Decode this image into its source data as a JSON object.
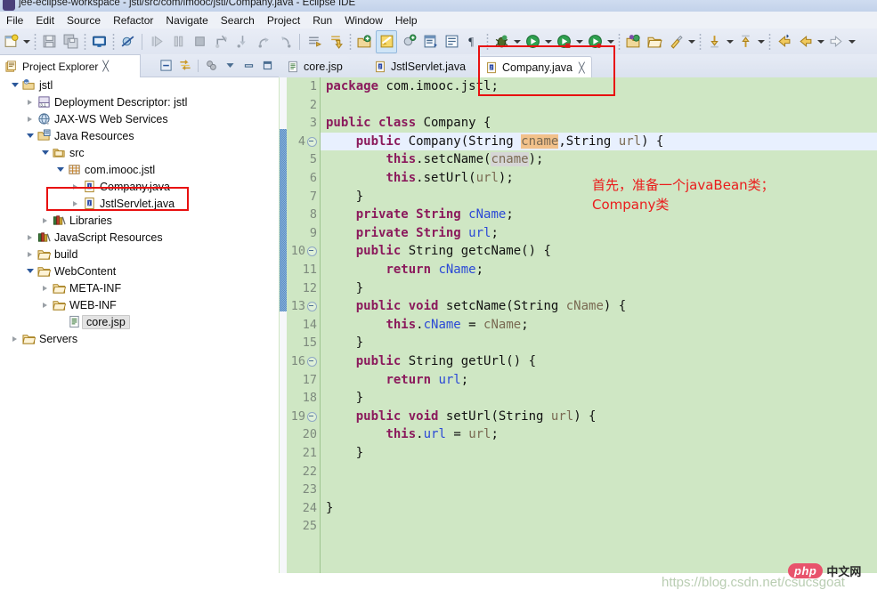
{
  "window": {
    "title": "jee-eclipse-workspace - jstl/src/com/imooc/jstl/Company.java - Eclipse IDE",
    "app_icon": "eclipse-icon"
  },
  "menu": {
    "items": [
      {
        "label": "File"
      },
      {
        "label": "Edit"
      },
      {
        "label": "Source"
      },
      {
        "label": "Refactor"
      },
      {
        "label": "Navigate"
      },
      {
        "label": "Search"
      },
      {
        "label": "Project"
      },
      {
        "label": "Run"
      },
      {
        "label": "Window"
      },
      {
        "label": "Help"
      }
    ]
  },
  "toolbar": {
    "items": [
      {
        "name": "new-wizard-icon",
        "type": "icon"
      },
      {
        "name": "new-wizard-dropdown",
        "type": "arrow"
      },
      {
        "name": "sep1",
        "type": "dots"
      },
      {
        "name": "save-icon",
        "type": "icon"
      },
      {
        "name": "save-all-icon",
        "type": "icon"
      },
      {
        "name": "sep2",
        "type": "dots"
      },
      {
        "name": "open-console-icon",
        "type": "icon"
      },
      {
        "name": "sep3",
        "type": "dots"
      },
      {
        "name": "skip-breakpoints-icon",
        "type": "icon"
      },
      {
        "name": "sep4",
        "type": "bar"
      },
      {
        "name": "resume-icon",
        "type": "icon"
      },
      {
        "name": "suspend-icon",
        "type": "icon"
      },
      {
        "name": "terminate-icon",
        "type": "icon"
      },
      {
        "name": "disconnect-icon",
        "type": "icon"
      },
      {
        "name": "step-into-icon",
        "type": "icon"
      },
      {
        "name": "step-over-icon",
        "type": "icon"
      },
      {
        "name": "step-return-icon",
        "type": "icon"
      },
      {
        "name": "sep5",
        "type": "bar"
      },
      {
        "name": "next-annotation-icon",
        "type": "icon"
      },
      {
        "name": "previous-annotation-icon",
        "type": "icon"
      },
      {
        "name": "sep6",
        "type": "dots"
      },
      {
        "name": "new-java-project-icon",
        "type": "icon"
      },
      {
        "name": "new-java-class-icon",
        "type": "icon"
      },
      {
        "name": "new-package-icon",
        "type": "icon"
      },
      {
        "name": "open-type-icon",
        "type": "icon"
      },
      {
        "name": "toggle-mark-occurrences-icon",
        "type": "icon"
      },
      {
        "name": "show-whitespace-icon",
        "type": "icon"
      },
      {
        "name": "sep7",
        "type": "dots"
      },
      {
        "name": "debug-icon",
        "type": "icon"
      },
      {
        "name": "debug-dropdown",
        "type": "arrow"
      },
      {
        "name": "run-icon",
        "type": "icon"
      },
      {
        "name": "run-dropdown",
        "type": "arrow"
      },
      {
        "name": "run-as-server-icon",
        "type": "icon"
      },
      {
        "name": "run-as-server-dropdown",
        "type": "arrow"
      },
      {
        "name": "coverage-icon",
        "type": "icon"
      },
      {
        "name": "coverage-dropdown",
        "type": "arrow"
      },
      {
        "name": "sep8",
        "type": "dots"
      },
      {
        "name": "new-server-icon",
        "type": "icon"
      },
      {
        "name": "open-folder-icon",
        "type": "icon"
      },
      {
        "name": "external-tools-icon",
        "type": "icon"
      },
      {
        "name": "external-tools-dropdown",
        "type": "arrow"
      },
      {
        "name": "sep9",
        "type": "dots"
      },
      {
        "name": "previous-edit-icon",
        "type": "icon"
      },
      {
        "name": "previous-edit-dropdown",
        "type": "arrow"
      },
      {
        "name": "next-edit-icon",
        "type": "icon"
      },
      {
        "name": "next-edit-dropdown",
        "type": "arrow"
      },
      {
        "name": "sep10",
        "type": "dots"
      },
      {
        "name": "back-history-icon",
        "type": "icon"
      },
      {
        "name": "back-alt-icon",
        "type": "icon"
      },
      {
        "name": "back-dropdown",
        "type": "arrow"
      },
      {
        "name": "forward-history-icon",
        "type": "icon"
      },
      {
        "name": "forward-dropdown",
        "type": "arrow"
      }
    ]
  },
  "project_explorer": {
    "tab_label": "Project Explorer",
    "tab_icon": "project-explorer-icon",
    "close_glyph": "╳",
    "view_tools": [
      {
        "name": "collapse-all-icon"
      },
      {
        "name": "link-with-editor-icon"
      },
      {
        "name": "focus-on-active-task-icon"
      },
      {
        "name": "view-menu-icon"
      },
      {
        "name": "minimize-view-icon"
      },
      {
        "name": "maximize-view-icon"
      }
    ],
    "tree": [
      {
        "label": "jstl",
        "indent": 0,
        "twist": "down",
        "icon": "java-project-icon",
        "selected": false
      },
      {
        "label": "Deployment Descriptor: jstl",
        "indent": 1,
        "twist": "right",
        "icon": "deployment-descriptor-icon",
        "selected": false
      },
      {
        "label": "JAX-WS Web Services",
        "indent": 1,
        "twist": "right",
        "icon": "jaxws-icon",
        "selected": false
      },
      {
        "label": "Java Resources",
        "indent": 1,
        "twist": "down",
        "icon": "java-resources-icon",
        "selected": false
      },
      {
        "label": "src",
        "indent": 2,
        "twist": "down",
        "icon": "source-folder-icon",
        "selected": false
      },
      {
        "label": "com.imooc.jstl",
        "indent": 3,
        "twist": "down",
        "icon": "package-icon",
        "selected": false
      },
      {
        "label": "Company.java",
        "indent": 4,
        "twist": "right",
        "icon": "java-file-icon",
        "selected": false
      },
      {
        "label": "JstlServlet.java",
        "indent": 4,
        "twist": "right",
        "icon": "java-file-icon",
        "selected": false
      },
      {
        "label": "Libraries",
        "indent": 2,
        "twist": "right",
        "icon": "library-icon",
        "selected": false
      },
      {
        "label": "JavaScript Resources",
        "indent": 1,
        "twist": "right",
        "icon": "library-icon",
        "selected": false
      },
      {
        "label": "build",
        "indent": 1,
        "twist": "right",
        "icon": "folder-icon",
        "selected": false
      },
      {
        "label": "WebContent",
        "indent": 1,
        "twist": "down",
        "icon": "folder-icon",
        "selected": false
      },
      {
        "label": "META-INF",
        "indent": 2,
        "twist": "right",
        "icon": "folder-icon",
        "selected": false
      },
      {
        "label": "WEB-INF",
        "indent": 2,
        "twist": "right",
        "icon": "folder-icon",
        "selected": false
      },
      {
        "label": "core.jsp",
        "indent": 3,
        "twist": "none",
        "icon": "jsp-file-icon",
        "selected": true
      },
      {
        "label": "Servers",
        "indent": 0,
        "twist": "right",
        "icon": "folder-icon",
        "selected": false
      }
    ]
  },
  "editor": {
    "tabs": [
      {
        "label": "core.jsp",
        "icon": "jsp-file-icon",
        "active": false,
        "closable": false
      },
      {
        "label": "JstlServlet.java",
        "icon": "java-file-icon",
        "active": false,
        "closable": false
      },
      {
        "label": "Company.java",
        "icon": "java-file-icon",
        "active": true,
        "closable": true,
        "close_glyph": "╳"
      }
    ],
    "current_line": 4,
    "lines": [
      {
        "n": 1,
        "fold": false,
        "tokens": [
          {
            "t": "package ",
            "c": "kw"
          },
          {
            "t": "com.imooc.jstl;",
            "c": "plain"
          }
        ]
      },
      {
        "n": 2,
        "fold": false,
        "tokens": []
      },
      {
        "n": 3,
        "fold": false,
        "tokens": [
          {
            "t": "public class ",
            "c": "kw"
          },
          {
            "t": "Company {",
            "c": "plain"
          }
        ]
      },
      {
        "n": 4,
        "fold": true,
        "tokens": [
          {
            "t": "    ",
            "c": "plain"
          },
          {
            "t": "public ",
            "c": "kw"
          },
          {
            "t": "Company(String ",
            "c": "plain"
          },
          {
            "t": "cname",
            "c": "par hl-write"
          },
          {
            "t": ",String ",
            "c": "plain"
          },
          {
            "t": "url",
            "c": "par"
          },
          {
            "t": ") {",
            "c": "plain"
          }
        ]
      },
      {
        "n": 5,
        "fold": false,
        "tokens": [
          {
            "t": "        ",
            "c": "plain"
          },
          {
            "t": "this",
            "c": "kw"
          },
          {
            "t": ".setcName(",
            "c": "plain"
          },
          {
            "t": "cname",
            "c": "par hl-occ"
          },
          {
            "t": ");",
            "c": "plain"
          }
        ]
      },
      {
        "n": 6,
        "fold": false,
        "tokens": [
          {
            "t": "        ",
            "c": "plain"
          },
          {
            "t": "this",
            "c": "kw"
          },
          {
            "t": ".setUrl(",
            "c": "plain"
          },
          {
            "t": "url",
            "c": "par"
          },
          {
            "t": ");",
            "c": "plain"
          }
        ]
      },
      {
        "n": 7,
        "fold": false,
        "tokens": [
          {
            "t": "    }",
            "c": "plain"
          }
        ]
      },
      {
        "n": 8,
        "fold": false,
        "tokens": [
          {
            "t": "    ",
            "c": "plain"
          },
          {
            "t": "private String ",
            "c": "kw"
          },
          {
            "t": "cName",
            "c": "fld"
          },
          {
            "t": ";",
            "c": "plain"
          }
        ]
      },
      {
        "n": 9,
        "fold": false,
        "tokens": [
          {
            "t": "    ",
            "c": "plain"
          },
          {
            "t": "private String ",
            "c": "kw"
          },
          {
            "t": "url",
            "c": "fld"
          },
          {
            "t": ";",
            "c": "plain"
          }
        ]
      },
      {
        "n": 10,
        "fold": true,
        "tokens": [
          {
            "t": "    ",
            "c": "plain"
          },
          {
            "t": "public ",
            "c": "kw"
          },
          {
            "t": "String getcName() {",
            "c": "plain"
          }
        ]
      },
      {
        "n": 11,
        "fold": false,
        "tokens": [
          {
            "t": "        ",
            "c": "plain"
          },
          {
            "t": "return ",
            "c": "kw"
          },
          {
            "t": "cName",
            "c": "fld"
          },
          {
            "t": ";",
            "c": "plain"
          }
        ]
      },
      {
        "n": 12,
        "fold": false,
        "tokens": [
          {
            "t": "    }",
            "c": "plain"
          }
        ]
      },
      {
        "n": 13,
        "fold": true,
        "tokens": [
          {
            "t": "    ",
            "c": "plain"
          },
          {
            "t": "public void ",
            "c": "kw"
          },
          {
            "t": "setcName(String ",
            "c": "plain"
          },
          {
            "t": "cName",
            "c": "par"
          },
          {
            "t": ") {",
            "c": "plain"
          }
        ]
      },
      {
        "n": 14,
        "fold": false,
        "tokens": [
          {
            "t": "        ",
            "c": "plain"
          },
          {
            "t": "this",
            "c": "kw"
          },
          {
            "t": ".",
            "c": "plain"
          },
          {
            "t": "cName",
            "c": "fld"
          },
          {
            "t": " = ",
            "c": "plain"
          },
          {
            "t": "cName",
            "c": "par"
          },
          {
            "t": ";",
            "c": "plain"
          }
        ]
      },
      {
        "n": 15,
        "fold": false,
        "tokens": [
          {
            "t": "    }",
            "c": "plain"
          }
        ]
      },
      {
        "n": 16,
        "fold": true,
        "tokens": [
          {
            "t": "    ",
            "c": "plain"
          },
          {
            "t": "public ",
            "c": "kw"
          },
          {
            "t": "String getUrl() {",
            "c": "plain"
          }
        ]
      },
      {
        "n": 17,
        "fold": false,
        "tokens": [
          {
            "t": "        ",
            "c": "plain"
          },
          {
            "t": "return ",
            "c": "kw"
          },
          {
            "t": "url",
            "c": "fld"
          },
          {
            "t": ";",
            "c": "plain"
          }
        ]
      },
      {
        "n": 18,
        "fold": false,
        "tokens": [
          {
            "t": "    }",
            "c": "plain"
          }
        ]
      },
      {
        "n": 19,
        "fold": true,
        "tokens": [
          {
            "t": "    ",
            "c": "plain"
          },
          {
            "t": "public void ",
            "c": "kw"
          },
          {
            "t": "setUrl(String ",
            "c": "plain"
          },
          {
            "t": "url",
            "c": "par"
          },
          {
            "t": ") {",
            "c": "plain"
          }
        ]
      },
      {
        "n": 20,
        "fold": false,
        "tokens": [
          {
            "t": "        ",
            "c": "plain"
          },
          {
            "t": "this",
            "c": "kw"
          },
          {
            "t": ".",
            "c": "plain"
          },
          {
            "t": "url",
            "c": "fld"
          },
          {
            "t": " = ",
            "c": "plain"
          },
          {
            "t": "url",
            "c": "par"
          },
          {
            "t": ";",
            "c": "plain"
          }
        ]
      },
      {
        "n": 21,
        "fold": false,
        "tokens": [
          {
            "t": "    }",
            "c": "plain"
          }
        ]
      },
      {
        "n": 22,
        "fold": false,
        "tokens": []
      },
      {
        "n": 23,
        "fold": false,
        "tokens": []
      },
      {
        "n": 24,
        "fold": false,
        "tokens": [
          {
            "t": "}",
            "c": "plain"
          }
        ]
      },
      {
        "n": 25,
        "fold": false,
        "tokens": []
      }
    ]
  },
  "annotation": {
    "text": "首先，准备一个javaBean类；\nCompany类",
    "color": "#ea1c1c"
  },
  "highlights": [
    {
      "name": "redbox-tree-company-java"
    },
    {
      "name": "redbox-editor-tab-company-java"
    }
  ],
  "watermark": {
    "url": "https://blog.csdn.net/csucsgoat",
    "logo_php": "php",
    "logo_cn": "中文网"
  }
}
